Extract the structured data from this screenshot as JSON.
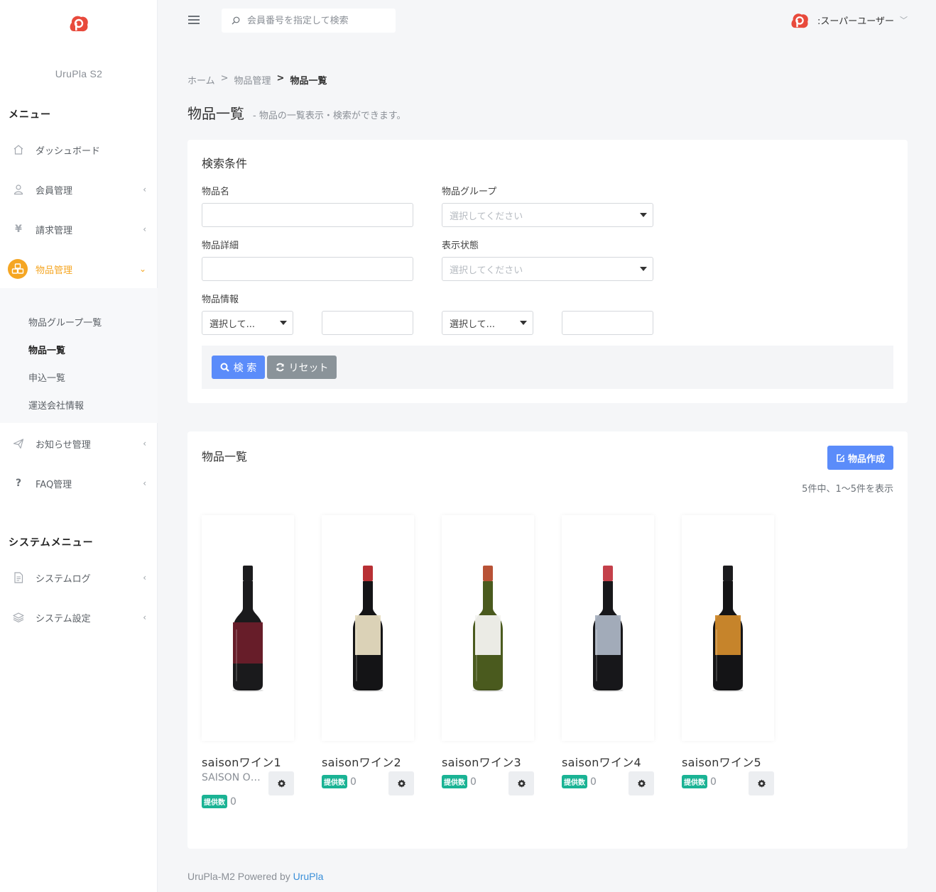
{
  "app": {
    "brand": "UruPla S2",
    "brand_color": "#e84a3c",
    "accent": "#f5a623",
    "primary": "#5b8cfa"
  },
  "sidebar": {
    "menu_heading": "メニュー",
    "items": [
      {
        "label": "ダッシュボード",
        "icon": "home-icon"
      },
      {
        "label": "会員管理",
        "icon": "user-icon"
      },
      {
        "label": "請求管理",
        "icon": "yen-icon"
      },
      {
        "label": "物品管理",
        "icon": "boxes-icon"
      },
      {
        "label": "お知らせ管理",
        "icon": "paper-plane-icon"
      },
      {
        "label": "FAQ管理",
        "icon": "question-icon"
      }
    ],
    "submenu": [
      "物品グループ一覧",
      "物品一覧",
      "申込一覧",
      "運送会社情報"
    ],
    "system_heading": "システムメニュー",
    "system_items": [
      {
        "label": "システムログ",
        "icon": "document-icon"
      },
      {
        "label": "システム設定",
        "icon": "layers-icon"
      }
    ]
  },
  "topbar": {
    "search_placeholder": "会員番号を指定して検索",
    "user_name": ":スーパーユーザー"
  },
  "breadcrumb": {
    "home": "ホーム",
    "parent": "物品管理",
    "current": "物品一覧",
    "sep1": ">",
    "sep2": ">"
  },
  "page": {
    "title": "物品一覧",
    "description": "-  物品の一覧表示・検索ができます。"
  },
  "search_panel": {
    "title": "検索条件",
    "name_label": "物品名",
    "group_label": "物品グループ",
    "group_placeholder": "選択してください",
    "detail_label": "物品詳細",
    "status_label": "表示状態",
    "status_placeholder": "選択してください",
    "info_label": "物品情報",
    "info_select1": "選択して...",
    "info_select2": "選択して...",
    "search_button": "検 索",
    "reset_button": "リセット"
  },
  "list_panel": {
    "title": "物品一覧",
    "create_button": "物品作成",
    "count_text": "5件中、1〜5件を表示",
    "offer_badge": "提供数",
    "products": [
      {
        "name": "saisonワイン1",
        "sub": "SAISON Official",
        "offered": "0",
        "cap": "#1c1c1e",
        "label": "#6b1d2a",
        "body": "#1a1a1c",
        "wide_label": true
      },
      {
        "name": "saisonワイン2",
        "sub": "",
        "offered": "0",
        "cap": "#b83034",
        "label": "#e6dcc0",
        "body": "#141416",
        "wide_label": false
      },
      {
        "name": "saisonワイン3",
        "sub": "",
        "offered": "0",
        "cap": "#b85236",
        "label": "#f3f3f0",
        "body": "#4a5a1e",
        "wide_label": false
      },
      {
        "name": "saisonワイン4",
        "sub": "",
        "offered": "0",
        "cap": "#c4404a",
        "label": "#aab3c2",
        "body": "#17171a",
        "wide_label": false
      },
      {
        "name": "saisonワイン5",
        "sub": "",
        "offered": "0",
        "cap": "#1c1c1e",
        "label": "#d08a2c",
        "body": "#141416",
        "wide_label": false
      }
    ]
  },
  "footer": {
    "text": "UruPla-M2 Powered by ",
    "link": "UruPla"
  }
}
